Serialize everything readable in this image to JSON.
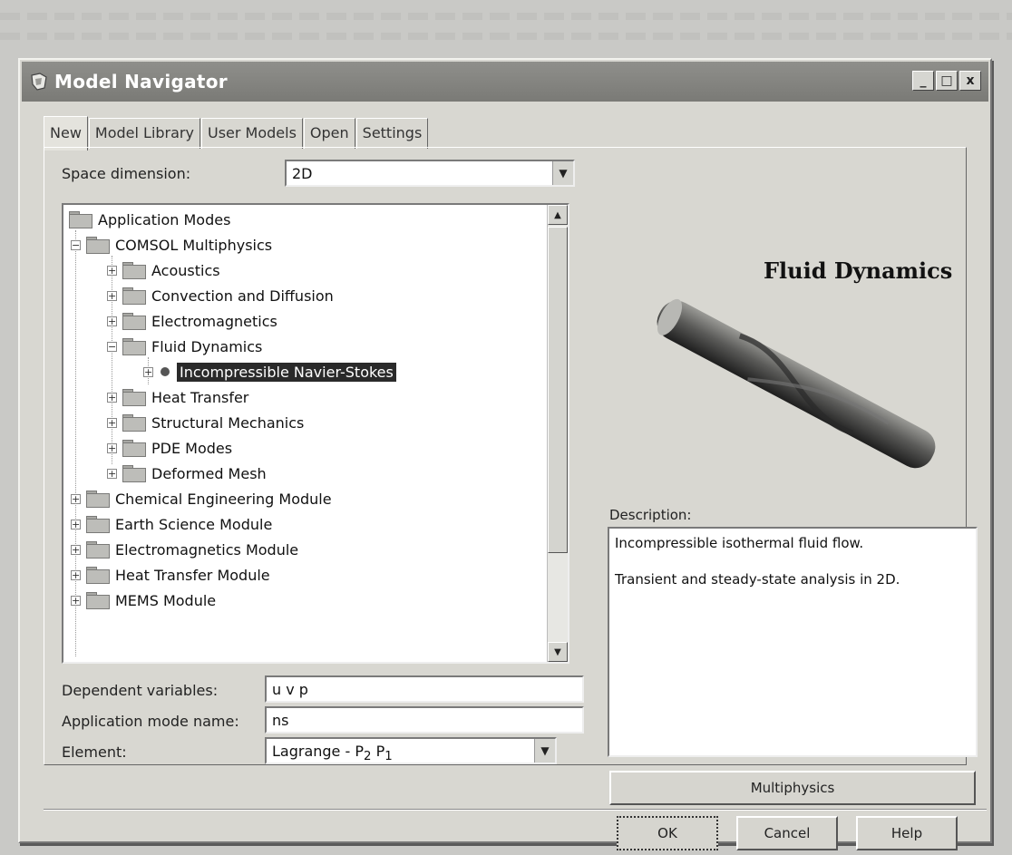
{
  "window": {
    "title": "Model Navigator",
    "controls": {
      "minimize": "_",
      "maximize": "□",
      "close": "x"
    }
  },
  "tabs": [
    {
      "label": "New",
      "active": true
    },
    {
      "label": "Model Library",
      "active": false
    },
    {
      "label": "User Models",
      "active": false
    },
    {
      "label": "Open",
      "active": false
    },
    {
      "label": "Settings",
      "active": false
    }
  ],
  "space_dimension": {
    "label": "Space dimension:",
    "value": "2D"
  },
  "tree": {
    "root": "Application Modes",
    "items": [
      {
        "label": "COMSOL Multiphysics",
        "expanded": true
      },
      {
        "label": "Acoustics"
      },
      {
        "label": "Convection and Diffusion"
      },
      {
        "label": "Electromagnetics"
      },
      {
        "label": "Fluid Dynamics",
        "expanded": true
      },
      {
        "label": "Incompressible Navier-Stokes",
        "selected": true
      },
      {
        "label": "Heat Transfer"
      },
      {
        "label": "Structural Mechanics"
      },
      {
        "label": "PDE Modes"
      },
      {
        "label": "Deformed Mesh"
      },
      {
        "label": "Chemical Engineering Module"
      },
      {
        "label": "Earth Science Module"
      },
      {
        "label": "Electromagnetics Module"
      },
      {
        "label": "Heat Transfer Module"
      },
      {
        "label": "MEMS Module"
      }
    ]
  },
  "fields": {
    "dependent_variables": {
      "label": "Dependent variables:",
      "value": "u v p"
    },
    "application_mode_name": {
      "label": "Application mode name:",
      "value": "ns"
    },
    "element": {
      "label": "Element:",
      "value": "Lagrange - P",
      "sub1": "2",
      "mid": " P",
      "sub2": "1"
    }
  },
  "preview": {
    "title": "Fluid Dynamics"
  },
  "description": {
    "label": "Description:",
    "line1": "Incompressible isothermal fluid flow.",
    "line2": "Transient and steady-state analysis in 2D."
  },
  "buttons": {
    "multiphysics": "Multiphysics",
    "ok": "OK",
    "cancel": "Cancel",
    "help": "Help"
  },
  "colors": {
    "selection": "#2a2a2a",
    "titlebar": "#848480",
    "dialog": "#d8d7d1"
  }
}
